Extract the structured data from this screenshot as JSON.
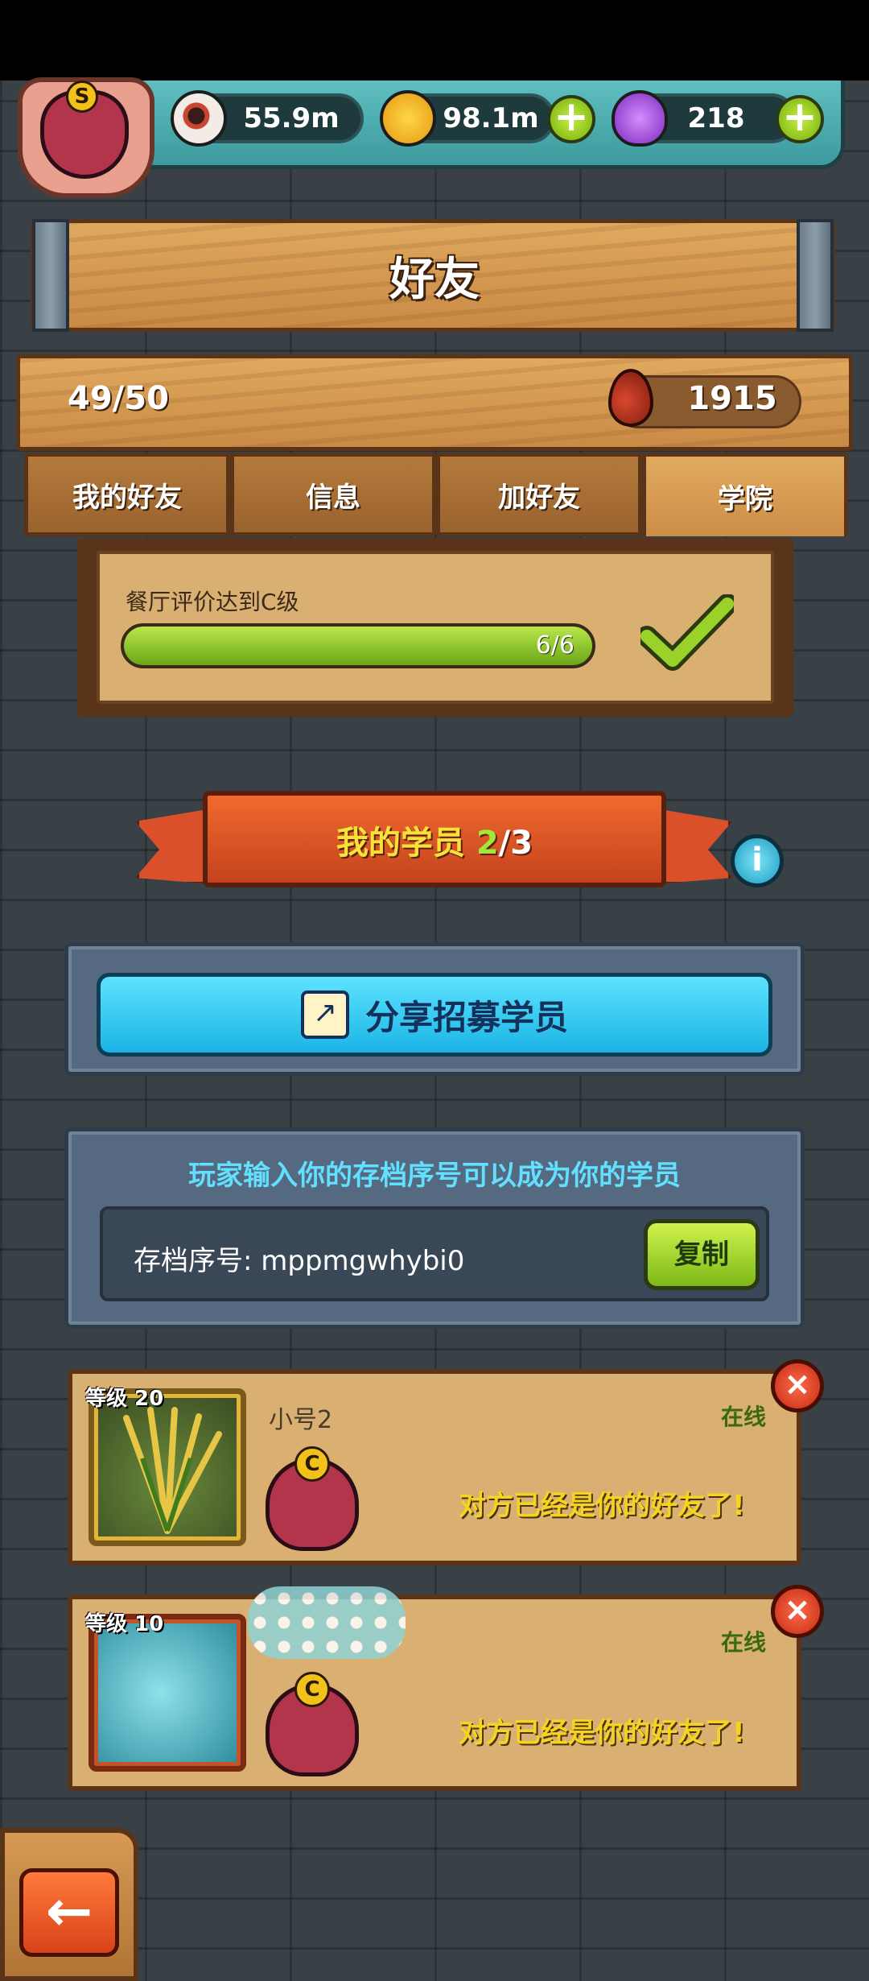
{
  "resources": {
    "eyes": "55.9m",
    "coins": "98.1m",
    "potions": "218",
    "rank_badge_letter": "S"
  },
  "header": {
    "title": "好友"
  },
  "stats": {
    "friend_count": "49/50",
    "blood": "1915"
  },
  "tabs": [
    {
      "label": "我的好友",
      "active": false
    },
    {
      "label": "信息",
      "active": false
    },
    {
      "label": "加好友",
      "active": false
    },
    {
      "label": "学院",
      "active": true
    }
  ],
  "task": {
    "label": "餐厅评价达到C级",
    "progress_text": "6/6",
    "progress_fraction": 1.0
  },
  "students_banner": {
    "label": "我的学员",
    "current": "2",
    "sep_total": "/3"
  },
  "share": {
    "button_label": "分享招募学员"
  },
  "code": {
    "hint": "玩家输入你的存档序号可以成为你的学员",
    "label": "存档序号: mppmgwhybi0",
    "copy_label": "复制"
  },
  "students": [
    {
      "level": "等级 20",
      "name": "小号2",
      "status": "在线",
      "message": "对方已经是你的好友了!",
      "rank_letter": "C",
      "avatar_icon": "wheat-icon"
    },
    {
      "level": "等级 10",
      "name": "",
      "status": "在线",
      "message": "对方已经是你的好友了!",
      "rank_letter": "C",
      "avatar_icon": "fish-monster-icon"
    }
  ],
  "icons": {
    "close": "×",
    "plus": "+",
    "info": "i",
    "back": "←",
    "share": "↗"
  }
}
